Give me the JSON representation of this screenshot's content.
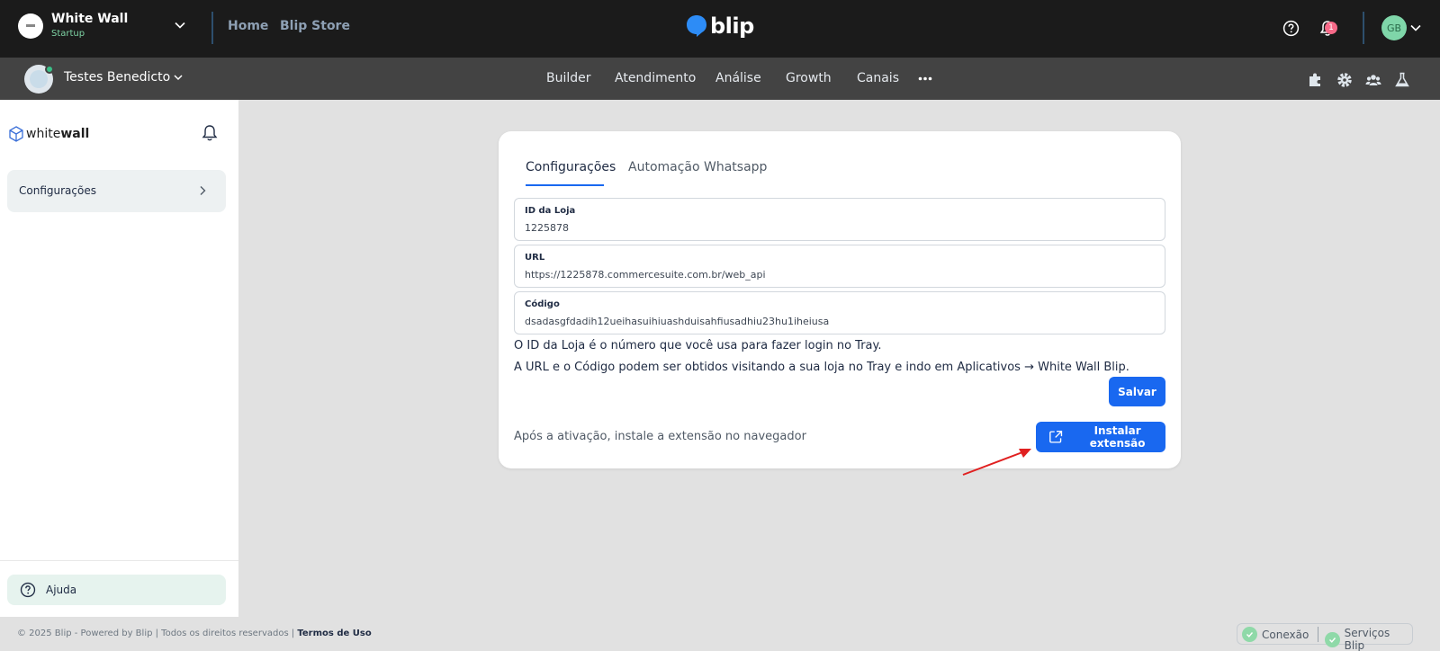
{
  "topbar": {
    "org_name": "White Wall",
    "org_plan": "Startup",
    "links": [
      "Home",
      "Blip Store"
    ],
    "logo_text": "blip",
    "notification_count": "1",
    "user_initials": "GB"
  },
  "subbar": {
    "bot_name": "Testes Benedicto",
    "nav": [
      "Builder",
      "Atendimento",
      "Análise",
      "Growth",
      "Canais"
    ],
    "icons": [
      "puzzle-icon",
      "gear-icon",
      "team-icon",
      "flask-icon"
    ]
  },
  "sidebar": {
    "logo_light": "white",
    "logo_bold": "wall",
    "item_label": "Configurações",
    "help_label": "Ajuda"
  },
  "card": {
    "tabs": [
      "Configurações",
      "Automação Whatsapp"
    ],
    "fields": [
      {
        "label": "ID da Loja",
        "value": "1225878"
      },
      {
        "label": "URL",
        "value": "https://1225878.commercesuite.com.br/web_api"
      },
      {
        "label": "Código",
        "value": "dsadasgfdadih12ueihasuihiuashduisahfiusadhiu23hu1iheiusa"
      }
    ],
    "hint1": "O ID da Loja é o número que você usa para fazer login no Tray.",
    "hint2": "A URL e o Código podem ser obtidos visitando a sua loja no Tray e indo em Aplicativos → White Wall Blip.",
    "save_label": "Salvar",
    "extension_note": "Após a ativação, instale a extensão no navegador",
    "extension_button": "Instalar extensão"
  },
  "footer": {
    "copyright": "© 2025 Blip - Powered by Blip | Todos os direitos reservados | ",
    "terms": "Termos de Uso",
    "status": [
      "Conexão",
      "Serviços Blip"
    ]
  },
  "colors": {
    "primary": "#1968f0",
    "topbar": "#1b1b1b",
    "subbar": "#434343",
    "annotation_arrow": "#e02020"
  }
}
